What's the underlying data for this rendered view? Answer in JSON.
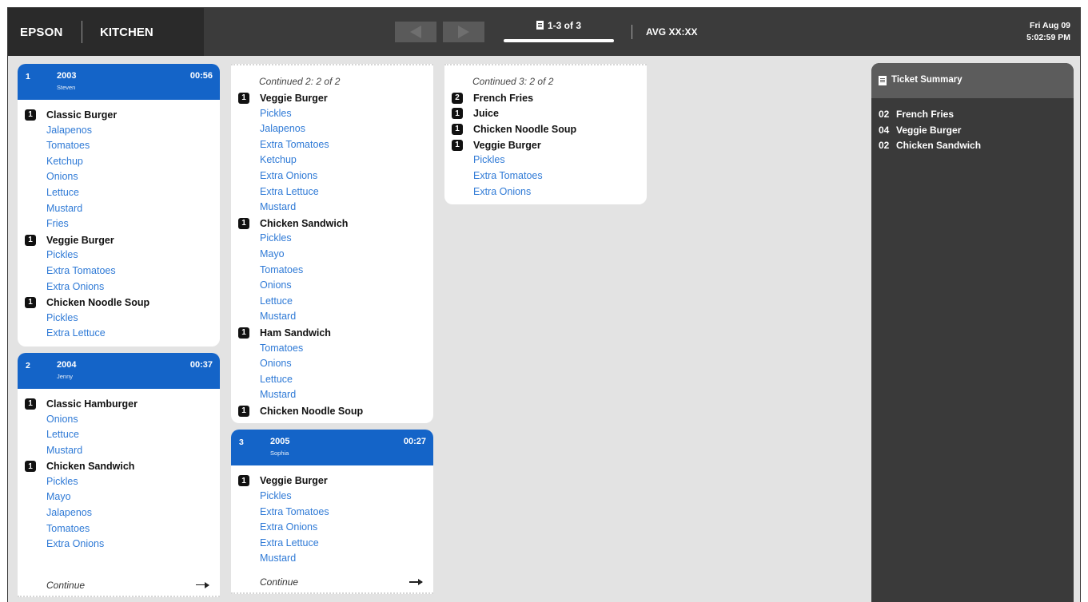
{
  "header": {
    "brand": "EPSON",
    "station": "KITCHEN",
    "page_indicator": "1-3 of 3",
    "avg": "AVG XX:XX",
    "date": "Fri Aug 09",
    "time": "5:02:59 PM",
    "icons": {
      "prev": "triangle-left-icon",
      "next": "triangle-right-icon",
      "page": "document-icon"
    }
  },
  "tickets": [
    {
      "position": "1",
      "number": "2003",
      "server": "Steven",
      "elapsed": "00:56",
      "items": [
        {
          "qty": "1",
          "name": "Classic Burger",
          "mods": [
            "Jalapenos",
            "Tomatoes",
            "Ketchup",
            "Onions",
            "Lettuce",
            "Mustard",
            "Fries"
          ]
        },
        {
          "qty": "1",
          "name": "Veggie Burger",
          "mods": [
            "Pickles",
            "Extra Tomatoes",
            "Extra Onions"
          ]
        },
        {
          "qty": "1",
          "name": "Chicken Noodle Soup",
          "mods": [
            "Pickles",
            "Extra Lettuce"
          ]
        }
      ]
    },
    {
      "position": "2",
      "number": "2004",
      "server": "Jenny",
      "elapsed": "00:37",
      "items": [
        {
          "qty": "1",
          "name": "Classic Hamburger",
          "mods": [
            "Onions",
            "Lettuce",
            "Mustard"
          ]
        },
        {
          "qty": "1",
          "name": "Chicken Sandwich",
          "mods": [
            "Pickles",
            "Mayo",
            "Jalapenos",
            "Tomatoes",
            "Extra Onions"
          ]
        }
      ],
      "continue_label": "Continue"
    },
    {
      "continued_label": "Continued 2: 2 of 2",
      "items": [
        {
          "qty": "1",
          "name": "Veggie Burger",
          "mods": [
            "Pickles",
            "Jalapenos",
            "Extra Tomatoes",
            "Ketchup",
            "Extra Onions",
            "Extra Lettuce",
            "Mustard"
          ]
        },
        {
          "qty": "1",
          "name": "Chicken Sandwich",
          "mods": [
            "Pickles",
            "Mayo",
            "Tomatoes",
            "Onions",
            "Lettuce",
            "Mustard"
          ]
        },
        {
          "qty": "1",
          "name": "Ham Sandwich",
          "mods": [
            "Tomatoes",
            "Onions",
            "Lettuce",
            "Mustard"
          ]
        },
        {
          "qty": "1",
          "name": "Chicken Noodle Soup",
          "mods": []
        }
      ]
    },
    {
      "position": "3",
      "number": "2005",
      "server": "Sophia",
      "elapsed": "00:27",
      "items": [
        {
          "qty": "1",
          "name": "Veggie Burger",
          "mods": [
            "Pickles",
            "Extra Tomatoes",
            "Extra Onions",
            "Extra Lettuce",
            "Mustard"
          ]
        }
      ],
      "continue_label": "Continue"
    },
    {
      "continued_label": "Continued 3: 2 of 2",
      "items": [
        {
          "qty": "2",
          "name": "French Fries",
          "mods": []
        },
        {
          "qty": "1",
          "name": "Juice",
          "mods": []
        },
        {
          "qty": "1",
          "name": "Chicken Noodle Soup",
          "mods": []
        },
        {
          "qty": "1",
          "name": "Veggie Burger",
          "mods": [
            "Pickles",
            "Extra Tomatoes",
            "Extra Onions"
          ]
        }
      ]
    }
  ],
  "summary": {
    "title": "Ticket Summary",
    "rows": [
      {
        "qty": "02",
        "name": "French Fries"
      },
      {
        "qty": "04",
        "name": "Veggie Burger"
      },
      {
        "qty": "02",
        "name": "Chicken Sandwich"
      }
    ]
  },
  "colors": {
    "header_bar": "#3b3b3b",
    "ticket_header": "#1464c8",
    "modifier_text": "#2f7ad6",
    "background": "#e3e3e3",
    "summary_panel": "#3a3a3a"
  }
}
